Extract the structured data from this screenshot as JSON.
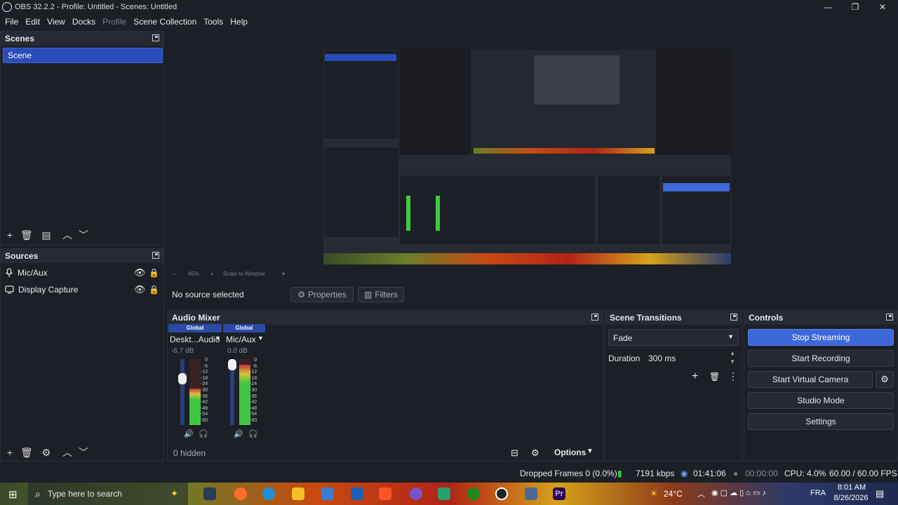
{
  "window": {
    "title": "OBS 32.2.2 - Profile: Untitled - Scenes: Untitled",
    "controls": {
      "minimize": "—",
      "restore": "❐",
      "close": "✕"
    }
  },
  "menu": [
    "File",
    "Edit",
    "View",
    "Docks",
    "Profile",
    "Scene Collection",
    "Tools",
    "Help"
  ],
  "scenes": {
    "title": "Scenes",
    "items": [
      {
        "label": "Scene",
        "selected": true
      }
    ]
  },
  "sources": {
    "title": "Sources",
    "items": [
      {
        "label": "Mic/Aux",
        "icon": "microphone-icon"
      },
      {
        "label": "Display Capture",
        "icon": "monitor-icon"
      }
    ]
  },
  "zoom": {
    "level": "45%",
    "mode": "Scale to Window"
  },
  "context": {
    "no_source": "No source selected",
    "properties": "Properties",
    "filters": "Filters"
  },
  "mixer": {
    "title": "Audio Mixer",
    "channels": [
      {
        "badge": "Global",
        "name": "Deskt...Audio",
        "db": "-6.7 dB",
        "level": 0.55
      },
      {
        "badge": "Global",
        "name": "Mic/Aux",
        "db": "0.0 dB",
        "level": 0.92
      }
    ],
    "scale": [
      "0",
      "-6",
      "-12",
      "-18",
      "-24",
      "-30",
      "-36",
      "-42",
      "-48",
      "-54",
      "-60"
    ],
    "hidden": "0 hidden",
    "options": "Options"
  },
  "transitions": {
    "title": "Scene Transitions",
    "selected": "Fade",
    "duration_label": "Duration",
    "duration_value": "300 ms"
  },
  "controls": {
    "title": "Controls",
    "stop_streaming": "Stop Streaming",
    "start_recording": "Start Recording",
    "start_virtual_camera": "Start Virtual Camera",
    "studio_mode": "Studio Mode",
    "settings": "Settings"
  },
  "status": {
    "dropped_frames": "Dropped Frames 0 (0.0%)",
    "bitrate": "7191 kbps",
    "stream_time": "01:41:06",
    "rec_time": "00:00:00",
    "cpu": "CPU: 4.0%",
    "fps": "60.00 / 60.00 FPS"
  },
  "taskbar": {
    "search_placeholder": "Type here to search",
    "temperature": "24°C",
    "language": "FRA",
    "time": "8:01 AM",
    "date": "8/26/2026"
  },
  "colors": {
    "accent": "#3d68d9",
    "selection": "#284cb8",
    "bg": "#1d1f26",
    "meter_green": "#3fc83f",
    "meter_yellow": "#d7c23a",
    "meter_red": "#c8323a"
  }
}
